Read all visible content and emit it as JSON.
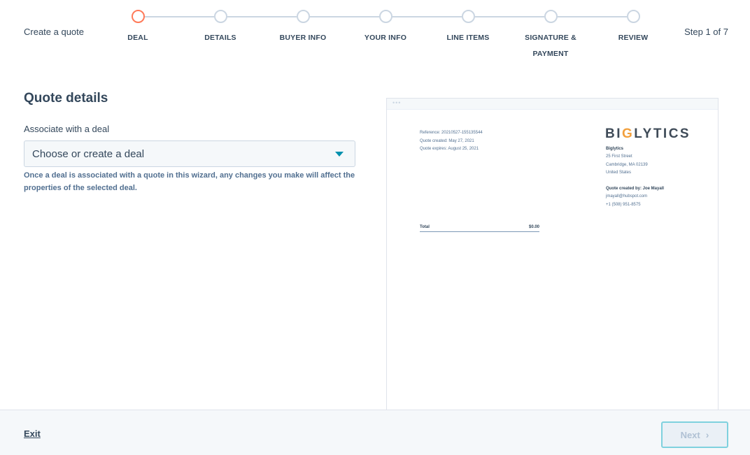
{
  "header": {
    "title": "Create a quote",
    "step_count": "Step 1 of 7",
    "steps": [
      {
        "label": "DEAL",
        "active": true
      },
      {
        "label": "DETAILS",
        "active": false
      },
      {
        "label": "BUYER INFO",
        "active": false
      },
      {
        "label": "YOUR INFO",
        "active": false
      },
      {
        "label": "LINE ITEMS",
        "active": false
      },
      {
        "label": "SIGNATURE & PAYMENT",
        "active": false
      },
      {
        "label": "REVIEW",
        "active": false
      }
    ]
  },
  "form": {
    "section_title": "Quote details",
    "deal_label": "Associate with a deal",
    "deal_select_value": "Choose or create a deal",
    "help_text": "Once a deal is associated with a quote in this wizard, any changes you make will affect the properties of the selected deal."
  },
  "preview": {
    "reference": "Reference: 20210527-155135544",
    "created": "Quote created: May 27, 2021",
    "expires": "Quote expires: August 25, 2021",
    "logo_prefix": "BI",
    "logo_o": "G",
    "logo_suffix": "LYTICS",
    "company_name": "Biglytics",
    "address_line1": "25 First Street",
    "address_line2": "Cambridge, MA 02139",
    "address_line3": "United States",
    "created_by": "Quote created by: Joe Mayall",
    "email": "jmayall@hubspot.com",
    "phone": "+1 (508) 951-8575",
    "total_label": "Total",
    "total_value": "$0.00"
  },
  "footer": {
    "exit_label": "Exit",
    "next_label": "Next"
  },
  "colors": {
    "active_step": "#ff7a59",
    "inactive_step": "#cbd6e2",
    "text": "#33475b",
    "caret": "#0091ae"
  }
}
